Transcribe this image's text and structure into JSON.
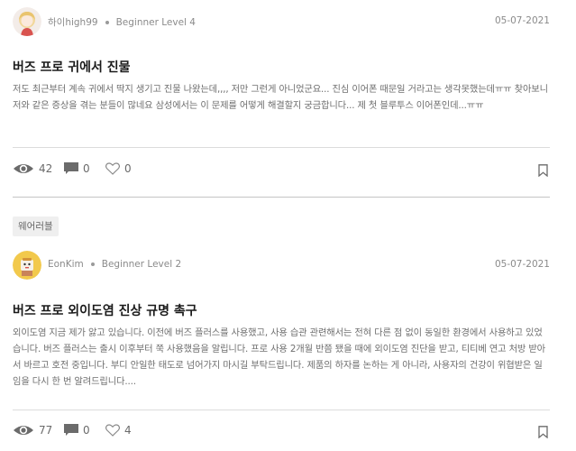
{
  "posts": [
    {
      "author": "하이high99",
      "level": "Beginner Level 4",
      "date": "05-07-2021",
      "title": "버즈 프로 귀에서 진물",
      "excerpt": "저도 최근부터 계속 귀에서 딱지 생기고 진물 나왔는데,,,, 저만 그런게 아니었군요... 진심 이어폰 때문일 거라고는 생각못했는데ㅠㅠ 찾아보니 저와 같은 증상을 겪는 분들이 많네요 삼성에서는 이 문제를 어떻게 해결할지 궁금합니다... 제 첫 블루투스 이어폰인데...ㅠㅠ",
      "views": "42",
      "comments": "0",
      "likes": "0"
    },
    {
      "tag": "웨어러블",
      "author": "EonKim",
      "level": "Beginner Level 2",
      "date": "05-07-2021",
      "title": "버즈 프로 외이도염 진상 규명 촉구",
      "excerpt": "외이도염 지금 제가 앓고 있습니다. 이전에 버즈 플러스를 사용했고, 사용 습관 관련해서는 전혀 다른 점 없이 동일한 환경에서 사용하고 있었습니다. 버즈 플러스는 출시 이후부터 쭉 사용했음을 알립니다. 프로 사용 2개월 반쯤 됐을 때에 외이도염 진단을 받고, 티티베 연고 처방 받아서 바르고 호전 중입니다. 부디 안일한 태도로 넘어가지 마시길 부탁드립니다. 제품의 하자를 논하는 게 아니라, 사용자의 건강이 위협받은 일임을 다시 한 번 알려드립니다....",
      "views": "77",
      "comments": "0",
      "likes": "4"
    }
  ],
  "icons": {
    "views": "eye-icon",
    "comments": "comment-icon",
    "likes": "heart-icon",
    "bookmark": "bookmark-icon"
  },
  "colors": {
    "icon_gray": "#6b6b6b",
    "meta_gray": "#8a8a8a"
  }
}
